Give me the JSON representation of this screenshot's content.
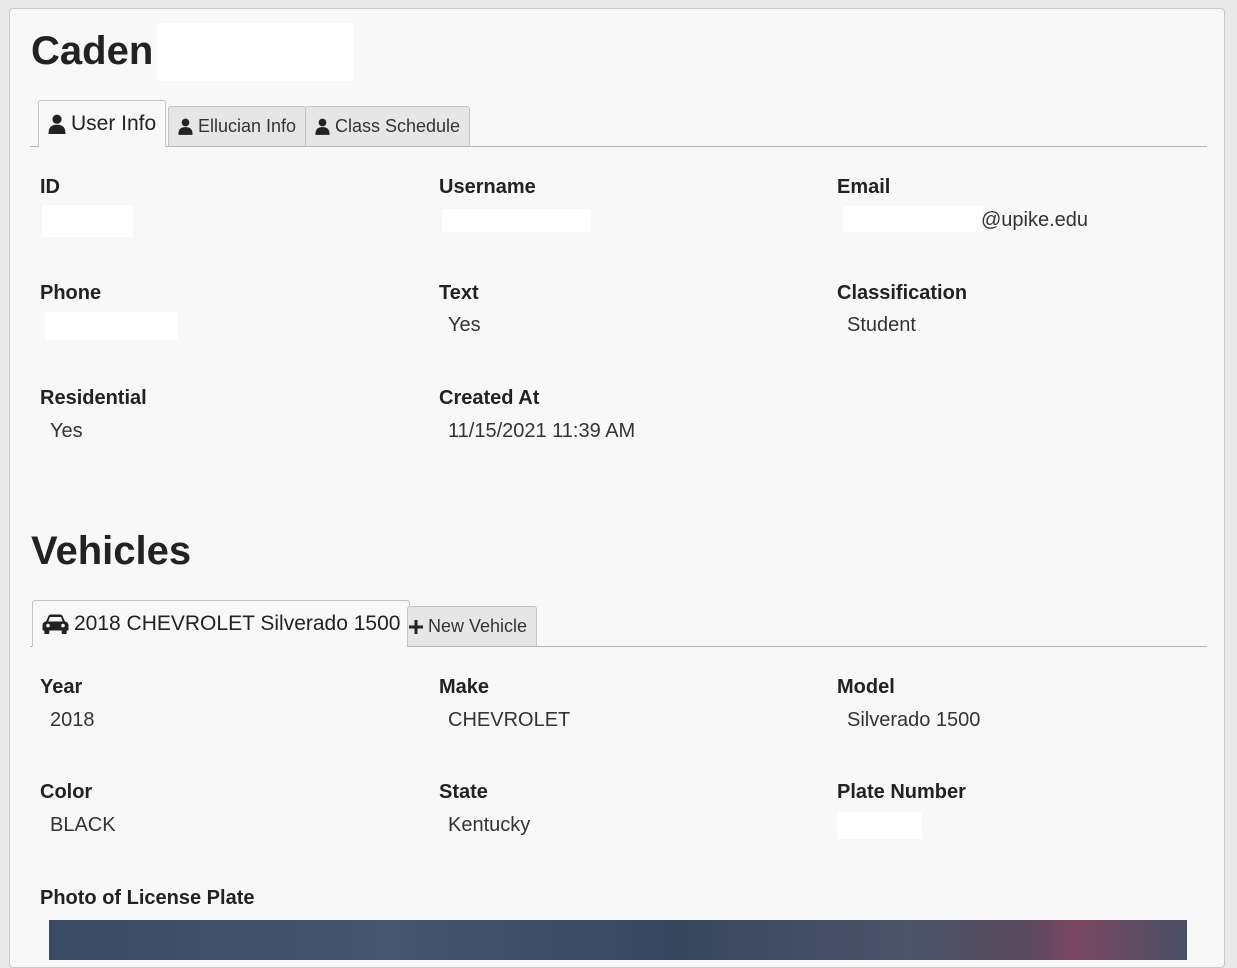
{
  "user": {
    "first_name": "Caden"
  },
  "user_tabs": [
    {
      "label": "User Info",
      "icon": "user-icon",
      "active": true
    },
    {
      "label": "Ellucian Info",
      "icon": "user-icon",
      "active": false
    },
    {
      "label": "Class Schedule",
      "icon": "user-icon",
      "active": false
    }
  ],
  "user_info": {
    "id_label": "ID",
    "username_label": "Username",
    "email_label": "Email",
    "email_domain": "@upike.edu",
    "phone_label": "Phone",
    "text_label": "Text",
    "text_value": "Yes",
    "classification_label": "Classification",
    "classification_value": "Student",
    "residential_label": "Residential",
    "residential_value": "Yes",
    "created_label": "Created At",
    "created_value": "11/15/2021 11:39 AM"
  },
  "vehicles": {
    "heading": "Vehicles",
    "tabs": [
      {
        "label": "2018 CHEVROLET Silverado 1500",
        "icon": "car-icon",
        "active": true
      },
      {
        "label": "New Vehicle",
        "icon": "plus-icon",
        "active": false
      }
    ],
    "year_label": "Year",
    "year_value": "2018",
    "make_label": "Make",
    "make_value": "CHEVROLET",
    "model_label": "Model",
    "model_value": "Silverado 1500",
    "color_label": "Color",
    "color_value": "BLACK",
    "state_label": "State",
    "state_value": "Kentucky",
    "plate_label": "Plate Number",
    "photo_label": "Photo of License Plate"
  }
}
